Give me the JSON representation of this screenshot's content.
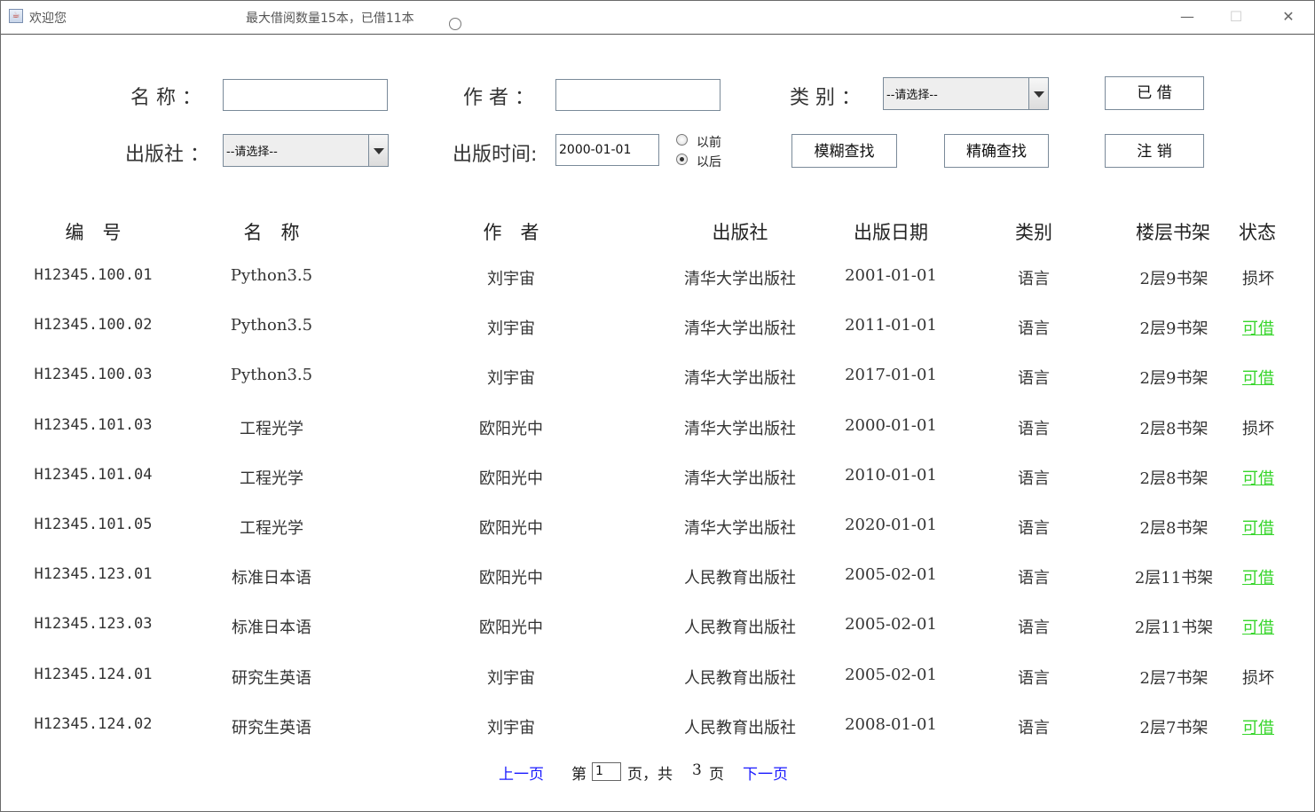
{
  "window": {
    "title": "欢迎您",
    "quota_text": "最大借阅数量15本，已借11本"
  },
  "search": {
    "name_label": "名 称 ：",
    "author_label": "作 者 ：",
    "category_label": "类 别 ：",
    "category_value": "--请选择--",
    "publisher_label": "出版社 ：",
    "publisher_value": "--请选择--",
    "date_label": "出版时间:",
    "date_value": "2000-01-01",
    "radio_before": "以前",
    "radio_after": "以后",
    "radio_selected": "以后",
    "borrowed_button": "已 借",
    "fuzzy_button": "模糊查找",
    "exact_button": "精确查找",
    "logout_button": "注 销"
  },
  "table": {
    "headers": [
      "编　号",
      "名　称",
      "作　者",
      "出版社",
      "出版日期",
      "类别",
      "楼层书架",
      "状态"
    ],
    "rows": [
      {
        "id": "H12345.100.01",
        "name": "Python3.5",
        "author": "刘宇宙",
        "publisher": "清华大学出版社",
        "date": "2001-01-01",
        "category": "语言",
        "shelf": "2层9书架",
        "status": "损坏"
      },
      {
        "id": "H12345.100.02",
        "name": "Python3.5",
        "author": "刘宇宙",
        "publisher": "清华大学出版社",
        "date": "2011-01-01",
        "category": "语言",
        "shelf": "2层9书架",
        "status": "可借"
      },
      {
        "id": "H12345.100.03",
        "name": "Python3.5",
        "author": "刘宇宙",
        "publisher": "清华大学出版社",
        "date": "2017-01-01",
        "category": "语言",
        "shelf": "2层9书架",
        "status": "可借"
      },
      {
        "id": "H12345.101.03",
        "name": "工程光学",
        "author": "欧阳光中",
        "publisher": "清华大学出版社",
        "date": "2000-01-01",
        "category": "语言",
        "shelf": "2层8书架",
        "status": "损坏"
      },
      {
        "id": "H12345.101.04",
        "name": "工程光学",
        "author": "欧阳光中",
        "publisher": "清华大学出版社",
        "date": "2010-01-01",
        "category": "语言",
        "shelf": "2层8书架",
        "status": "可借"
      },
      {
        "id": "H12345.101.05",
        "name": "工程光学",
        "author": "欧阳光中",
        "publisher": "清华大学出版社",
        "date": "2020-01-01",
        "category": "语言",
        "shelf": "2层8书架",
        "status": "可借"
      },
      {
        "id": "H12345.123.01",
        "name": "标准日本语",
        "author": "欧阳光中",
        "publisher": "人民教育出版社",
        "date": "2005-02-01",
        "category": "语言",
        "shelf": "2层11书架",
        "status": "可借"
      },
      {
        "id": "H12345.123.03",
        "name": "标准日本语",
        "author": "欧阳光中",
        "publisher": "人民教育出版社",
        "date": "2005-02-01",
        "category": "语言",
        "shelf": "2层11书架",
        "status": "可借"
      },
      {
        "id": "H12345.124.01",
        "name": "研究生英语",
        "author": "刘宇宙",
        "publisher": "人民教育出版社",
        "date": "2005-02-01",
        "category": "语言",
        "shelf": "2层7书架",
        "status": "损坏"
      },
      {
        "id": "H12345.124.02",
        "name": "研究生英语",
        "author": "刘宇宙",
        "publisher": "人民教育出版社",
        "date": "2008-01-01",
        "category": "语言",
        "shelf": "2层7书架",
        "status": "可借"
      }
    ]
  },
  "pagination": {
    "prev": "上一页",
    "page_prefix": "第",
    "current_page": "1",
    "page_middle": "页，共",
    "total_pages": "3",
    "page_suffix": "页",
    "next": "下一页"
  },
  "colors": {
    "available": "#36d52a",
    "link": "#1a1aff"
  }
}
